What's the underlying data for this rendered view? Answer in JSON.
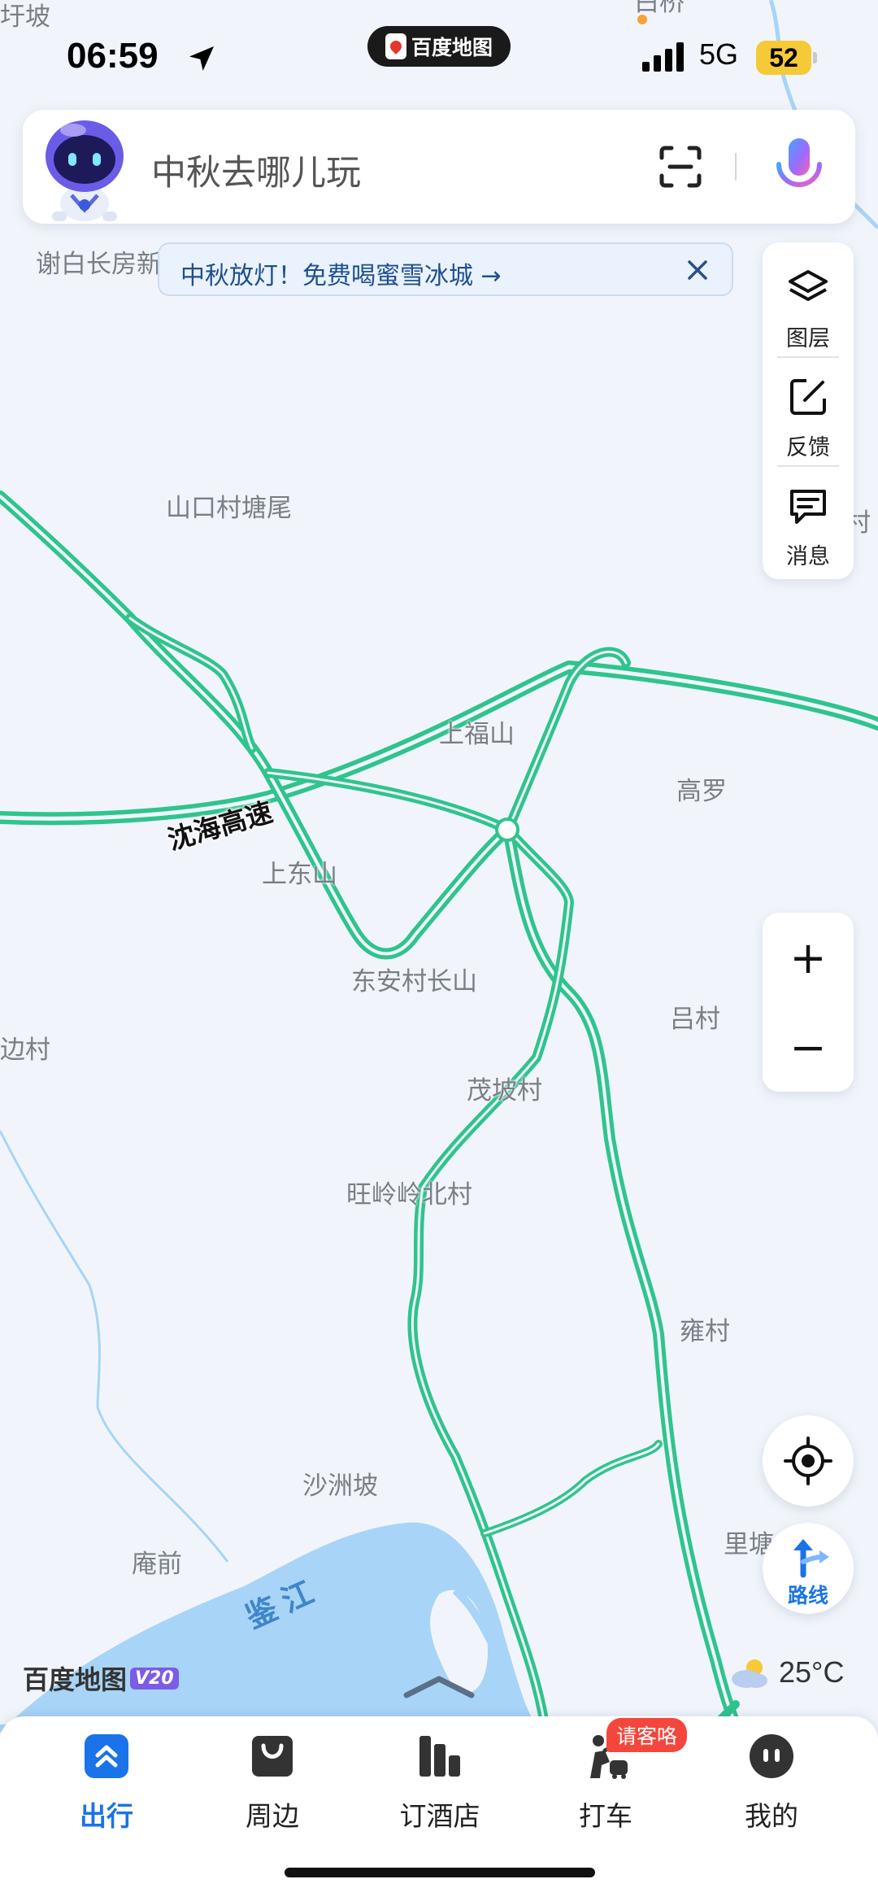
{
  "status_bar": {
    "time": "06:59",
    "app_name": "百度地图",
    "network": "5G",
    "battery": "52"
  },
  "search": {
    "placeholder": "中秋去哪儿玩"
  },
  "banner": {
    "text": "中秋放灯！免费喝蜜雪冰城 →"
  },
  "tools": {
    "layers": "图层",
    "feedback": "反馈",
    "messages": "消息"
  },
  "zoom": {
    "in": "+",
    "out": "−"
  },
  "route": {
    "label": "路线"
  },
  "brand": {
    "name": "百度地图",
    "version": "V20"
  },
  "weather": {
    "temperature": "25°C"
  },
  "map": {
    "road_name": "沈海高速",
    "river_name": "鉴江",
    "places": {
      "top_left": "圩坡",
      "top_center": "白桥",
      "xiebai": "谢白长房新",
      "shankou": "山口村塘尾",
      "right_cut": "村",
      "shangfu": "上福山",
      "gaoluo": "高罗",
      "shangdong": "上东山",
      "dongan": "东安村长山",
      "lvcun": "吕村",
      "left_village": "边村",
      "maopo": "茂坡村",
      "wangling": "旺岭岭北村",
      "yongcun": "雍村",
      "shazhou": "沙洲坡",
      "anqian": "庵前",
      "litang": "里塘"
    }
  },
  "nav": {
    "travel": "出行",
    "nearby": "周边",
    "hotel": "订酒店",
    "taxi": "打车",
    "taxi_badge": "请客咯",
    "mine": "我的"
  },
  "colors": {
    "road": "#2fc48d",
    "water": "#a8d4f7",
    "accent": "#1a73e8",
    "map_bg": "#f1f5fb"
  }
}
